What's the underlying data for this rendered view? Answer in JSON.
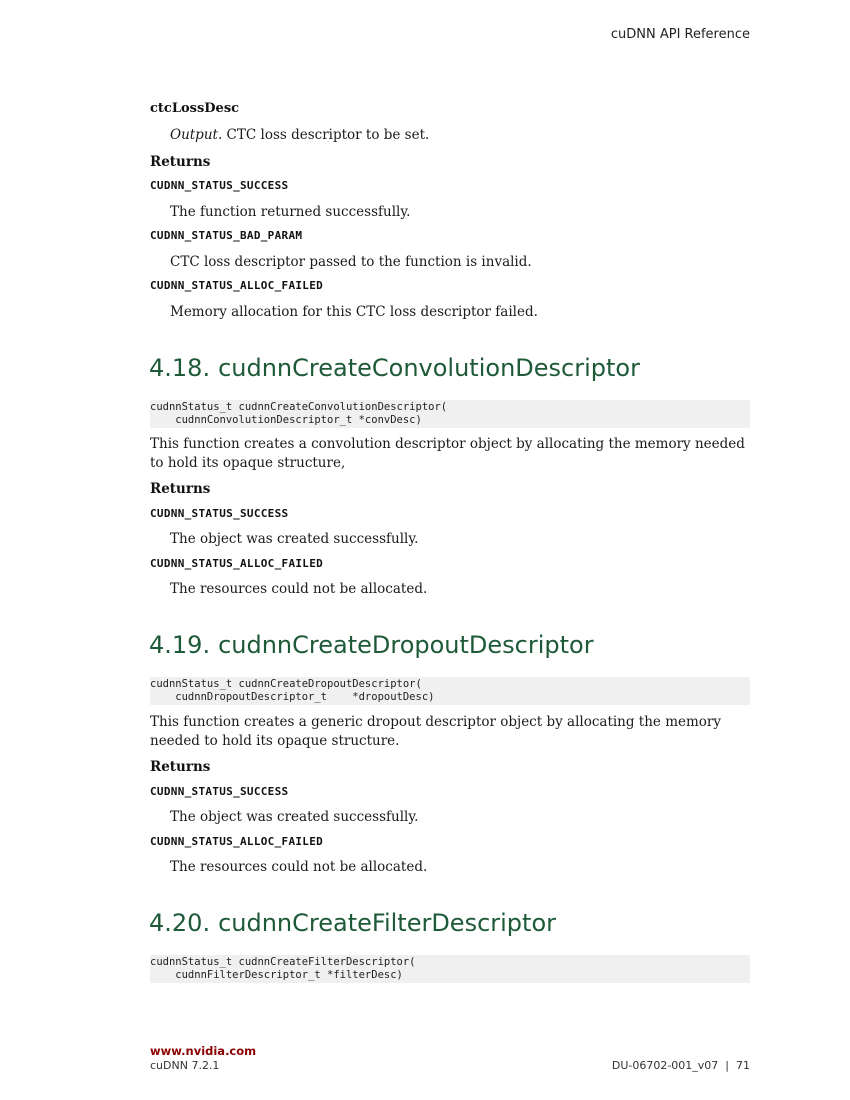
{
  "header": {
    "title": "cuDNN API Reference"
  },
  "intro": {
    "param_name": "ctcLossDesc",
    "param_italic": "Output.",
    "param_desc": " CTC loss descriptor to be set.",
    "returns_label": "Returns",
    "returns": [
      {
        "code": "CUDNN_STATUS_SUCCESS",
        "desc": "The function returned successfully."
      },
      {
        "code": "CUDNN_STATUS_BAD_PARAM",
        "desc": "CTC loss descriptor passed to the function is invalid."
      },
      {
        "code": "CUDNN_STATUS_ALLOC_FAILED",
        "desc": "Memory allocation for this CTC loss descriptor failed."
      }
    ]
  },
  "sections": [
    {
      "number": "4.18.",
      "title": "cudnnCreateConvolutionDescriptor",
      "code_lines": [
        "cudnnStatus_t cudnnCreateConvolutionDescriptor(",
        "    cudnnConvolutionDescriptor_t *convDesc)"
      ],
      "description": "This function creates a convolution descriptor object by allocating the memory needed to hold its opaque structure,",
      "returns_label": "Returns",
      "returns": [
        {
          "code": "CUDNN_STATUS_SUCCESS",
          "desc": "The object was created successfully."
        },
        {
          "code": "CUDNN_STATUS_ALLOC_FAILED",
          "desc": "The resources could not be allocated."
        }
      ]
    },
    {
      "number": "4.19.",
      "title": "cudnnCreateDropoutDescriptor",
      "code_lines": [
        "cudnnStatus_t cudnnCreateDropoutDescriptor(",
        "    cudnnDropoutDescriptor_t    *dropoutDesc)"
      ],
      "description": "This function creates a generic dropout descriptor object by allocating the memory needed to hold its opaque structure.",
      "returns_label": "Returns",
      "returns": [
        {
          "code": "CUDNN_STATUS_SUCCESS",
          "desc": "The object was created successfully."
        },
        {
          "code": "CUDNN_STATUS_ALLOC_FAILED",
          "desc": "The resources could not be allocated."
        }
      ]
    },
    {
      "number": "4.20.",
      "title": "cudnnCreateFilterDescriptor",
      "code_lines": [
        "cudnnStatus_t cudnnCreateFilterDescriptor(",
        "    cudnnFilterDescriptor_t *filterDesc)"
      ]
    }
  ],
  "footer": {
    "site": "www.nvidia.com",
    "product": "cuDNN 7.2.1",
    "doc_id": "DU-06702-001_v07  |  71"
  }
}
